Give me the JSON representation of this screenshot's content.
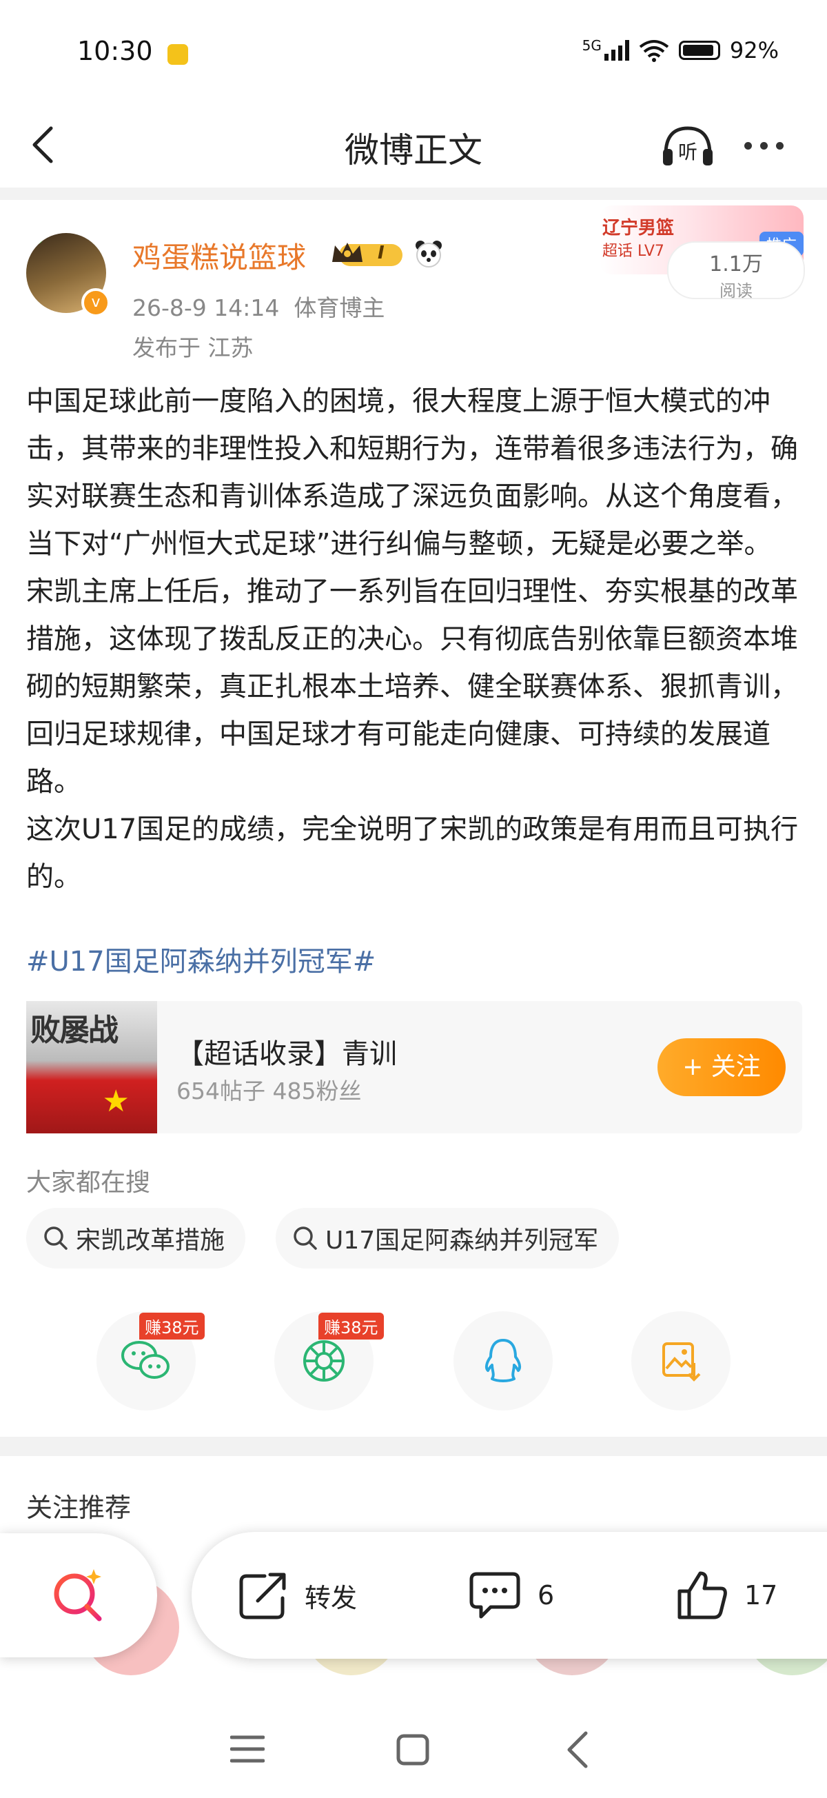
{
  "status_bar": {
    "time": "10:30",
    "network": "5G",
    "battery": "92%"
  },
  "header": {
    "title": "微博正文"
  },
  "post": {
    "author": {
      "name": "鸡蛋糕说篮球",
      "level_badge": "I",
      "verified_badge": "v"
    },
    "meta": "26-8-9 14:14  体育博主",
    "location": "发布于 江苏",
    "paragraphs": [
      "中国足球此前一度陷入的困境，很大程度上源于恒大模式的冲击，其带来的非理性投入和短期行为，连带着很多违法行为，确实对联赛生态和青训体系造成了深远负面影响。从这个角度看，当下对“广州恒大式足球”进行纠偏与整顿，无疑是必要之举。",
      "宋凯主席上任后，推动了一系列旨在回归理性、夯实根基的改革措施，这体现了拨乱反正的决心。只有彻底告别依靠巨额资本堆砌的短期繁荣，真正扎根本土培养、健全联赛体系、狠抓青训，回归足球规律，中国足球才有可能走向健康、可持续的发展道路。",
      "这次U17国足的成绩，完全说明了宋凯的政策是有用而且可执行的。"
    ],
    "hashtag": "#U17国足阿森纳并列冠军#"
  },
  "ad": {
    "title": "辽宁男篮",
    "subtitle": "超话 LV7",
    "tag": "推广",
    "read_count": "1.1万",
    "read_label": "阅读"
  },
  "super_topic": {
    "image_text": "败屡战",
    "title": "【超话收录】青训",
    "stats": "654帖子 485粉丝",
    "follow_label": "+ 关注"
  },
  "hot_search": {
    "heading": "大家都在搜",
    "chips": [
      "宋凯改革措施",
      "U17国足阿森纳并列冠军"
    ]
  },
  "share": {
    "reward_label": "赚38元",
    "items": [
      "wechat-icon",
      "moments-icon",
      "qq-icon",
      "save-image-icon"
    ]
  },
  "recommend": {
    "heading": "关注推荐"
  },
  "actions": {
    "repost_label": "转发",
    "comment_count": "6",
    "like_count": "17"
  },
  "colors": {
    "author_name": "#e8782a",
    "hashtag": "#4a6fa5",
    "follow_button": "#ff9a10",
    "reward_badge": "#e8412a"
  }
}
